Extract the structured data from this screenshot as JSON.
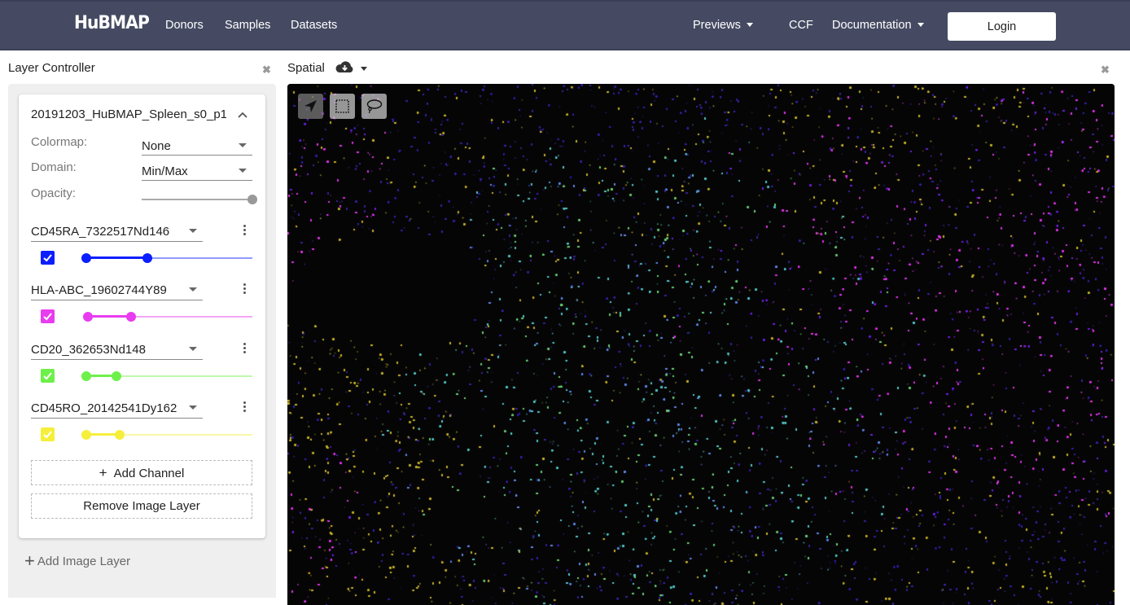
{
  "navbar": {
    "brand": "HuBMAP",
    "links": [
      {
        "label": "Donors"
      },
      {
        "label": "Samples"
      },
      {
        "label": "Datasets"
      }
    ],
    "right_links": [
      {
        "label": "Previews",
        "dropdown": true
      },
      {
        "label": "CCF",
        "dropdown": false
      },
      {
        "label": "Documentation",
        "dropdown": true
      }
    ],
    "login_label": "Login",
    "background_color": "#454a62"
  },
  "layer_controller": {
    "title": "Layer Controller",
    "close_icon": "close-x-icon",
    "layer": {
      "name": "20191203_HuBMAP_Spleen_s0_p1",
      "collapse_icon": "chevron-up-icon",
      "colormap_label": "Colormap:",
      "colormap_value": "None",
      "domain_label": "Domain:",
      "domain_value": "Min/Max",
      "opacity_label": "Opacity:",
      "opacity_value": 1.0,
      "channels": [
        {
          "name": "CD45RA_7322517Nd146",
          "color": "#0a1eff",
          "checked": true,
          "range_low": 0.0,
          "range_high": 0.37
        },
        {
          "name": "HLA-ABC_19602744Y89",
          "color": "#e83cf0",
          "checked": true,
          "range_low": 0.01,
          "range_high": 0.27
        },
        {
          "name": "CD20_362653Nd148",
          "color": "#6ef04a",
          "checked": true,
          "range_low": 0.0,
          "range_high": 0.18
        },
        {
          "name": "CD45RO_20142541Dy162",
          "color": "#f5ef3c",
          "checked": true,
          "range_low": 0.0,
          "range_high": 0.2
        }
      ],
      "add_channel_label": "Add Channel",
      "remove_layer_label": "Remove Image Layer"
    },
    "add_image_layer_label": "Add Image Layer"
  },
  "spatial": {
    "title": "Spatial",
    "download_icon": "cloud-download-icon",
    "close_icon": "close-x-icon",
    "tools": [
      {
        "name": "pan-tool",
        "icon": "navigation-arrow-icon",
        "active": true
      },
      {
        "name": "rectangle-select-tool",
        "icon": "dotted-rectangle-icon",
        "active": false
      },
      {
        "name": "lasso-select-tool",
        "icon": "lasso-icon",
        "active": false
      }
    ]
  }
}
